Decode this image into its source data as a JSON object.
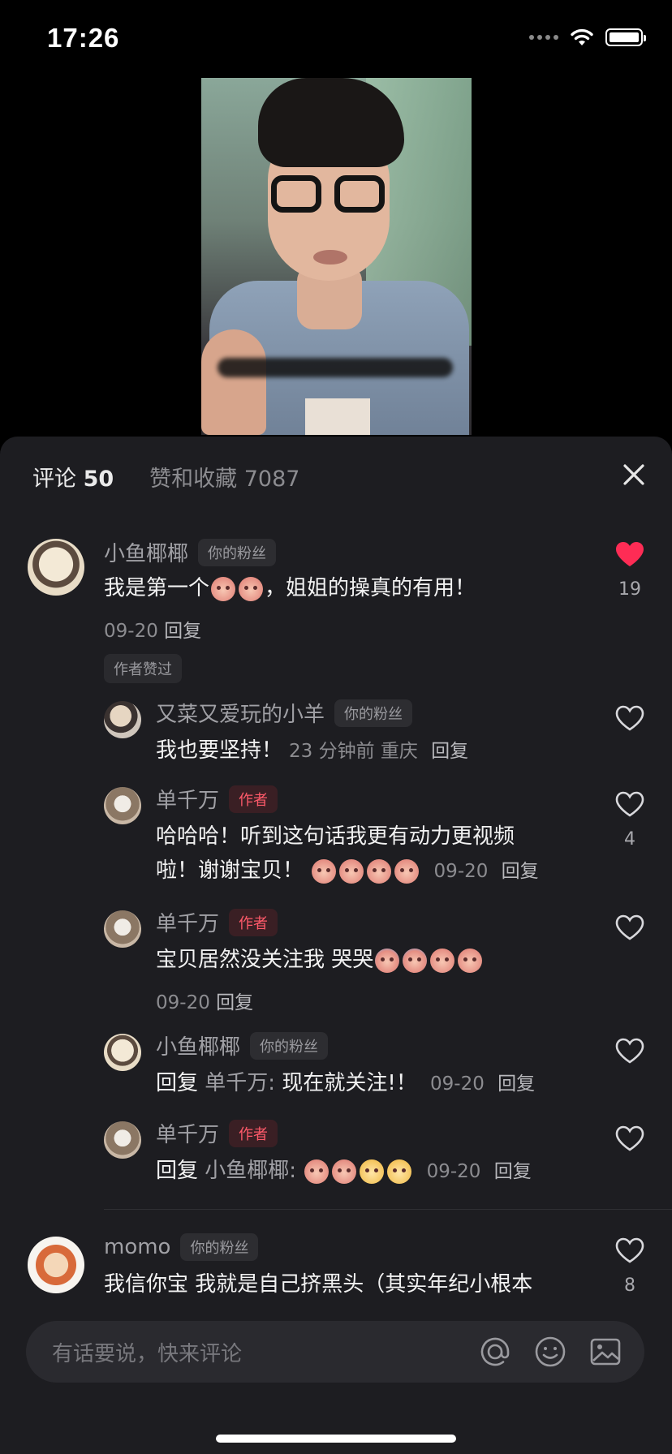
{
  "status_bar": {
    "time": "17:26"
  },
  "sheet": {
    "tab_comments_label": "评论",
    "tab_comments_count": "50",
    "tab_likes_label": "赞和收藏 7087"
  },
  "comments": [
    {
      "name": "小鱼椰椰",
      "badge": "你的粉丝",
      "text": "我是第一个",
      "text_tail": "，姐姐的操真的有用！",
      "date": "09-20",
      "reply": "回复",
      "likes": "19",
      "liked": true,
      "author_liked": "作者赞过"
    }
  ],
  "replies": [
    {
      "name": "又菜又爱玩的小羊",
      "badge": "你的粉丝",
      "text": "我也要坚持！",
      "meta": "23 分钟前 重庆",
      "reply": "回复"
    },
    {
      "name": "单千万",
      "badge": "作者",
      "text_line1": "哈哈哈！听到这句话我更有动力更视频",
      "text_line2": "啦！谢谢宝贝！",
      "date": "09-20",
      "reply": "回复",
      "likes": "4"
    },
    {
      "name": "单千万",
      "badge": "作者",
      "text": "宝贝居然没关注我 哭哭",
      "date": "09-20",
      "reply": "回复"
    },
    {
      "name": "小鱼椰椰",
      "badge": "你的粉丝",
      "reply_prefix": "回复",
      "reply_to": "单千万:",
      "text": "现在就关注!！",
      "date": "09-20",
      "reply": "回复"
    },
    {
      "name": "单千万",
      "badge": "作者",
      "reply_prefix": "回复",
      "reply_to": "小鱼椰椰:",
      "date": "09-20",
      "reply": "回复"
    }
  ],
  "last_comment": {
    "name": "momo",
    "badge": "你的粉丝",
    "text": "我信你宝 我就是自己挤黑头（其实年纪小根本",
    "likes": "8"
  },
  "input": {
    "placeholder": "有话要说，快来评论"
  },
  "colors": {
    "accent_red": "#fe2c55",
    "sheet_bg": "#1d1d21"
  }
}
